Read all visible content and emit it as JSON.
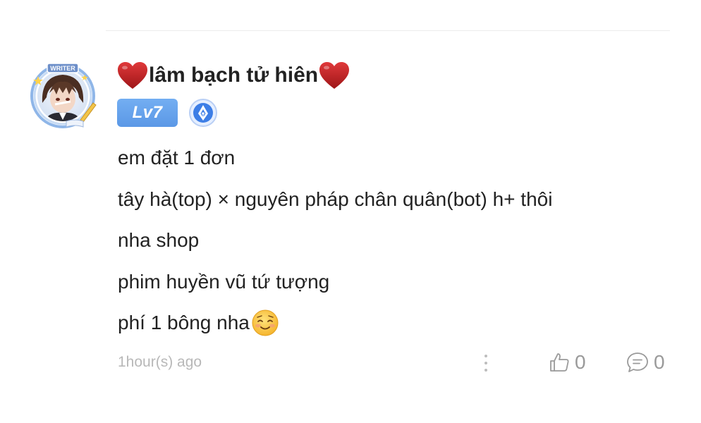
{
  "comment": {
    "author": {
      "name": "lâm bạch tử hiên",
      "level": "Lv7",
      "avatar_banner": "WRITER",
      "name_decoration_icon": "heart-icon",
      "writer_badge_icon": "pen-nib-icon"
    },
    "content": {
      "lines": [
        "em đặt 1 đơn",
        "tây hà(top) × nguyên pháp chân quân(bot) h+ thôi",
        "nha shop",
        "phim huyền vũ tứ tượng",
        "phí 1 bông nha"
      ],
      "trailing_emoji": "smiling-face-emoji"
    },
    "footer": {
      "timestamp": "1hour(s) ago",
      "like_count": "0",
      "reply_count": "0"
    }
  },
  "colors": {
    "level_badge": "#5b98e6",
    "heart": "#c0282a",
    "meta_text": "#b8b8b8",
    "icon_gray": "#9a9a9a"
  }
}
